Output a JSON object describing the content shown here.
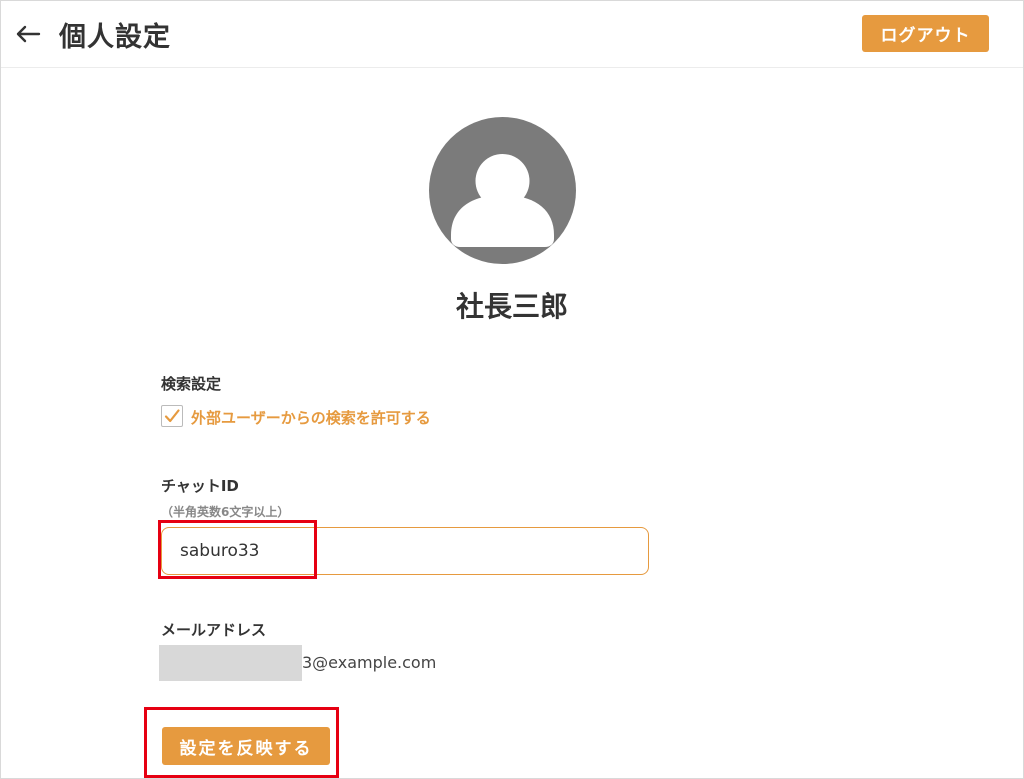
{
  "header": {
    "back_icon": "arrow-left-icon",
    "title": "個人設定",
    "logout_label": "ログアウト"
  },
  "profile": {
    "avatar_icon": "user-silhouette-icon",
    "name": "社長三郎"
  },
  "search_settings": {
    "label": "検索設定",
    "checkbox_checked": true,
    "checkbox_label": "外部ユーザーからの検索を許可する"
  },
  "chat_id": {
    "label": "チャットID",
    "hint": "（半角英数6文字以上）",
    "value": "saburo33"
  },
  "email": {
    "label": "メールアドレス",
    "visible_suffix": "3@example.com"
  },
  "apply_label": "設定を反映する",
  "colors": {
    "accent": "#e69a3f",
    "highlight": "#e60012",
    "avatar_bg": "#7b7b7b"
  }
}
